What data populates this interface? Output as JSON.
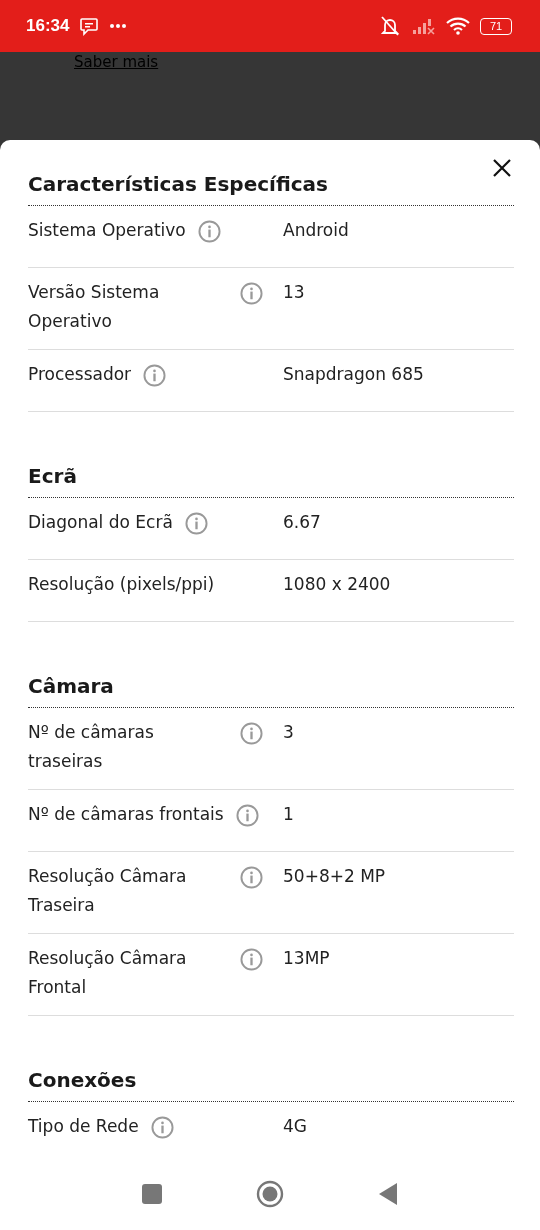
{
  "status_bar": {
    "time": "16:34",
    "battery": "71"
  },
  "background": {
    "link": "Saber mais"
  },
  "sheet": {
    "sections": [
      {
        "title": "Características Específicas",
        "rows": [
          {
            "label": "Sistema Operativo",
            "info": true,
            "value": "Android"
          },
          {
            "label": "Versão Sistema Operativo",
            "info": true,
            "value": "13"
          },
          {
            "label": "Processador",
            "info": true,
            "value": "Snapdragon 685"
          }
        ]
      },
      {
        "title": "Ecrã",
        "rows": [
          {
            "label": "Diagonal do Ecrã",
            "info": true,
            "value": "6.67"
          },
          {
            "label": "Resolução (pixels/ppi)",
            "info": false,
            "value": "1080 x 2400"
          }
        ]
      },
      {
        "title": "Câmara",
        "rows": [
          {
            "label": "Nº de câmaras traseiras",
            "info": true,
            "value": "3"
          },
          {
            "label": "Nº de câmaras frontais",
            "info": true,
            "value": "1"
          },
          {
            "label": "Resolução Câmara Traseira",
            "info": true,
            "value": "50+8+2 MP"
          },
          {
            "label": "Resolução Câmara Frontal",
            "info": true,
            "value": "13MP"
          }
        ]
      },
      {
        "title": "Conexões",
        "rows": [
          {
            "label": "Tipo de Rede",
            "info": true,
            "value": "4G"
          }
        ]
      }
    ]
  }
}
